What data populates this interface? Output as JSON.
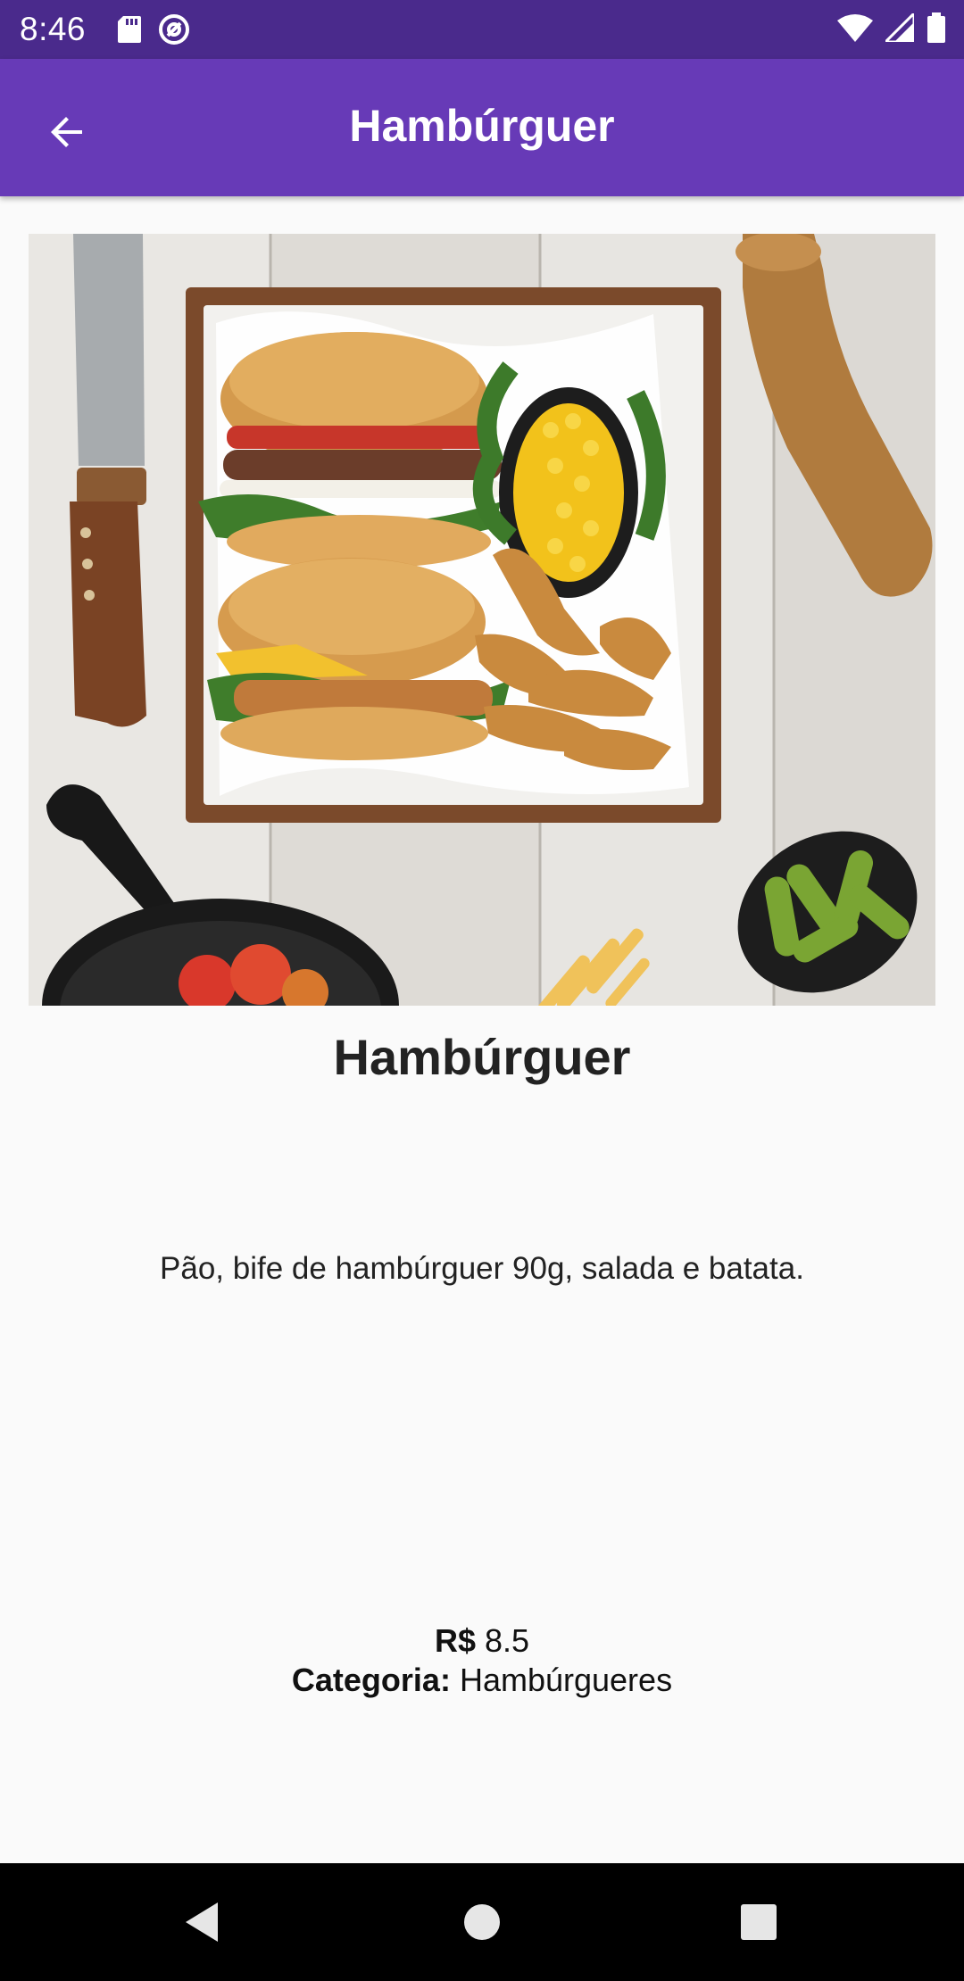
{
  "status_bar": {
    "time": "8:46",
    "left_icons": [
      "sd-card-icon",
      "sync-at-icon"
    ],
    "right_icons": [
      "wifi-icon",
      "signal-icon",
      "battery-icon"
    ]
  },
  "app_bar": {
    "title": "Hambúrguer",
    "back_icon": "arrow-back-icon",
    "color": "#673ab7"
  },
  "product": {
    "image_alt": "Hambúrguer",
    "name": "Hambúrguer",
    "description": "Pão, bife de hambúrguer 90g, salada e batata.",
    "price_label": "R$",
    "price_value": "8.5",
    "category_label": "Categoria:",
    "category_value": "Hambúrgueres"
  },
  "nav_bar": {
    "buttons": [
      "back-triangle-icon",
      "home-circle-icon",
      "recents-square-icon"
    ]
  }
}
